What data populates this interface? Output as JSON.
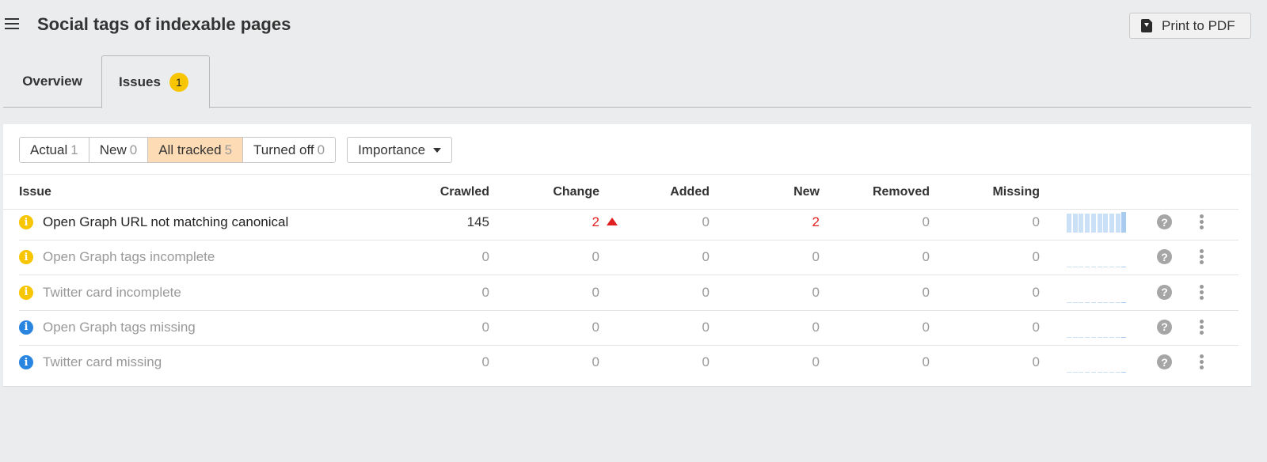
{
  "header": {
    "title": "Social tags of indexable pages",
    "print_label": "Print to PDF"
  },
  "tabs": [
    {
      "label": "Overview",
      "active": false
    },
    {
      "label": "Issues",
      "active": true,
      "badge": "1"
    }
  ],
  "filters": {
    "segments": [
      {
        "label": "Actual",
        "count": "1",
        "active": false
      },
      {
        "label": "New",
        "count": "0",
        "active": false
      },
      {
        "label": "All tracked",
        "count": "5",
        "active": true
      },
      {
        "label": "Turned off",
        "count": "0",
        "active": false
      }
    ],
    "sort_label": "Importance"
  },
  "table": {
    "columns": [
      "Issue",
      "Crawled",
      "Change",
      "Added",
      "New",
      "Removed",
      "Missing"
    ],
    "rows": [
      {
        "severity": "warning",
        "name": "Open Graph URL not matching canonical",
        "crawled": "145",
        "change": "2",
        "change_dir": "up",
        "added": "0",
        "new": "2",
        "removed": "0",
        "missing": "0",
        "active": true,
        "trend": [
          1,
          1,
          1,
          1,
          1,
          1,
          1,
          1,
          1,
          1
        ]
      },
      {
        "severity": "warning",
        "name": "Open Graph tags incomplete",
        "crawled": "0",
        "change": "0",
        "added": "0",
        "new": "0",
        "removed": "0",
        "missing": "0",
        "active": false,
        "trend": [
          0,
          0,
          0,
          0,
          0,
          0,
          0,
          0,
          0,
          0
        ]
      },
      {
        "severity": "warning",
        "name": "Twitter card incomplete",
        "crawled": "0",
        "change": "0",
        "added": "0",
        "new": "0",
        "removed": "0",
        "missing": "0",
        "active": false,
        "trend": [
          0,
          0,
          0,
          0,
          0,
          0,
          0,
          0,
          0,
          0
        ]
      },
      {
        "severity": "notice",
        "name": "Open Graph tags missing",
        "crawled": "0",
        "change": "0",
        "added": "0",
        "new": "0",
        "removed": "0",
        "missing": "0",
        "active": false,
        "trend": [
          0,
          0,
          0,
          0,
          0,
          0,
          0,
          0,
          0,
          0
        ]
      },
      {
        "severity": "notice",
        "name": "Twitter card missing",
        "crawled": "0",
        "change": "0",
        "added": "0",
        "new": "0",
        "removed": "0",
        "missing": "0",
        "active": false,
        "trend": [
          0,
          0,
          0,
          0,
          0,
          0,
          0,
          0,
          0,
          0
        ]
      }
    ]
  },
  "colors": {
    "warning": "#f7c600",
    "notice": "#2a85e0",
    "negative": "#e02020",
    "active_filter": "#fddbb4",
    "spark": "#c9e0f6",
    "spark_last": "#a9cbef"
  },
  "icons": {
    "info": "i",
    "help": "?"
  }
}
